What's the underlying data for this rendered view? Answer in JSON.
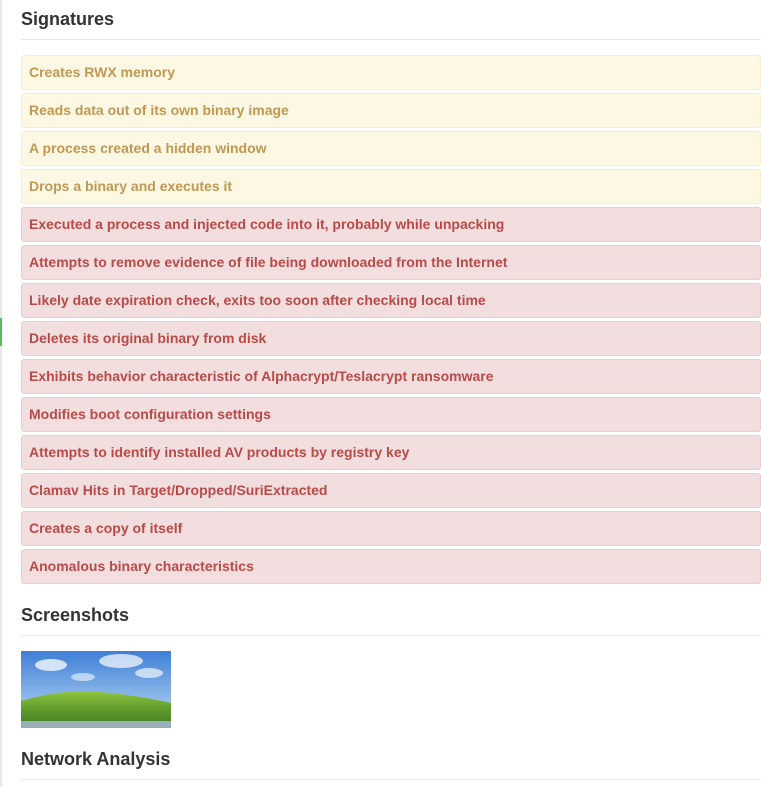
{
  "signatures": {
    "title": "Signatures",
    "items": [
      {
        "label": "Creates RWX memory",
        "severity": "warning"
      },
      {
        "label": "Reads data out of its own binary image",
        "severity": "warning"
      },
      {
        "label": "A process created a hidden window",
        "severity": "warning"
      },
      {
        "label": "Drops a binary and executes it",
        "severity": "warning"
      },
      {
        "label": "Executed a process and injected code into it, probably while unpacking",
        "severity": "danger"
      },
      {
        "label": "Attempts to remove evidence of file being downloaded from the Internet",
        "severity": "danger"
      },
      {
        "label": "Likely date expiration check, exits too soon after checking local time",
        "severity": "danger"
      },
      {
        "label": "Deletes its original binary from disk",
        "severity": "danger"
      },
      {
        "label": "Exhibits behavior characteristic of Alphacrypt/Teslacrypt ransomware",
        "severity": "danger"
      },
      {
        "label": "Modifies boot configuration settings",
        "severity": "danger"
      },
      {
        "label": "Attempts to identify installed AV products by registry key",
        "severity": "danger"
      },
      {
        "label": "Clamav Hits in Target/Dropped/SuriExtracted",
        "severity": "danger"
      },
      {
        "label": "Creates a copy of itself",
        "severity": "danger"
      },
      {
        "label": "Anomalous binary characteristics",
        "severity": "danger"
      }
    ]
  },
  "screenshots": {
    "title": "Screenshots",
    "thumbnail_icon": "desktop-screenshot-thumbnail"
  },
  "network": {
    "title": "Network Analysis"
  },
  "colors": {
    "warning_bg": "#fcf8e3",
    "warning_text": "#c09853",
    "danger_bg": "#f2dede",
    "danger_text": "#b94a48"
  }
}
